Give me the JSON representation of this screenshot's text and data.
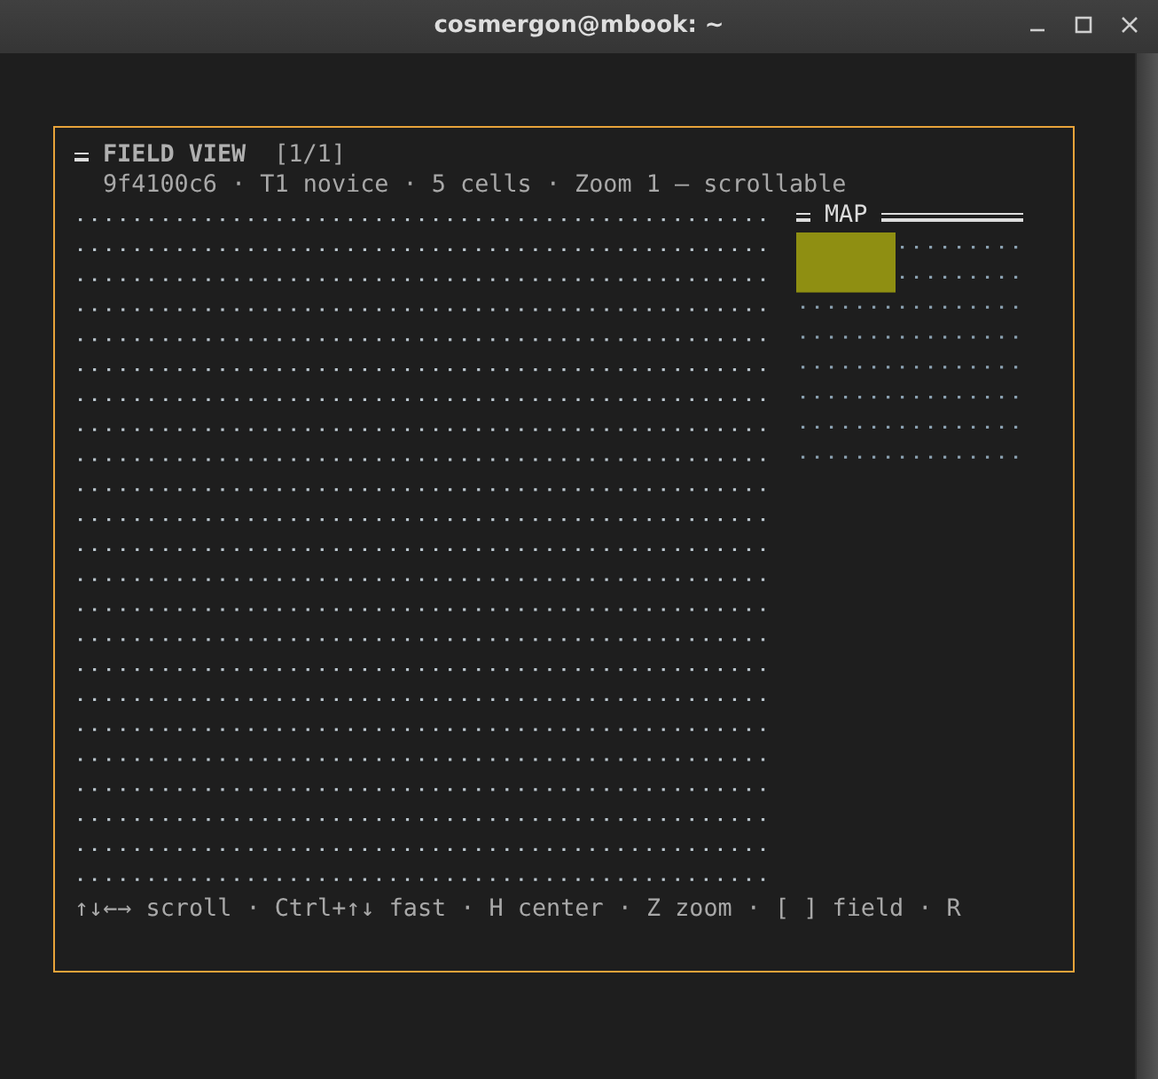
{
  "window": {
    "title": "cosmergon@mbook: ~"
  },
  "panel": {
    "title": "FIELD VIEW",
    "page": "[1/1]",
    "subtitle": "9f4100c6 · T1 novice · 5 cells · Zoom 1 — scrollable"
  },
  "map": {
    "title": "MAP"
  },
  "footer": "↑↓←→ scroll · Ctrl+↑↓ fast · H center · Z zoom · [ ] field · R"
}
